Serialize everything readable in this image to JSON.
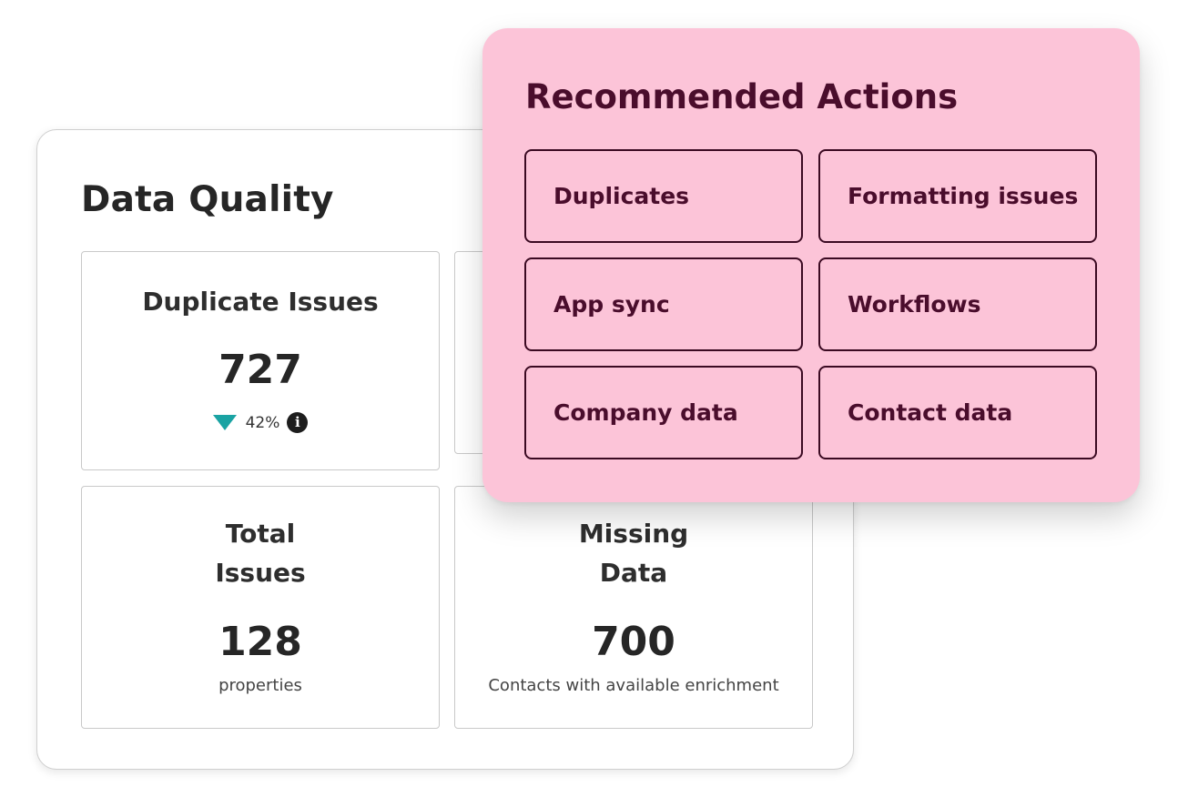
{
  "data_quality": {
    "title": "Data Quality",
    "duplicate_issues": {
      "title": "Duplicate Issues",
      "value": "727",
      "change": "42%",
      "change_direction": "down",
      "change_color": "#1aa3a3",
      "info_icon": "i"
    },
    "total_issues": {
      "title": "Total\nIssues",
      "value": "128",
      "subtitle": "properties"
    },
    "missing_data": {
      "title": "Missing\nData",
      "value": "700",
      "subtitle": "Contacts with available enrichment"
    }
  },
  "recommended_actions": {
    "title": "Recommended Actions",
    "background_color": "#fcc4d8",
    "actions": [
      {
        "label": "Duplicates"
      },
      {
        "label": "Formatting issues"
      },
      {
        "label": "App sync"
      },
      {
        "label": "Workflows"
      },
      {
        "label": "Company data"
      },
      {
        "label": "Contact data"
      }
    ]
  }
}
